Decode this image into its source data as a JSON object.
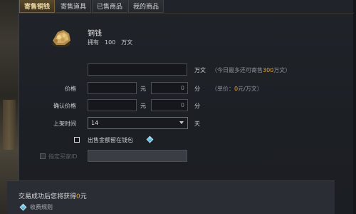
{
  "tabs": [
    {
      "label": "寄售铜钱",
      "active": true
    },
    {
      "label": "寄售道具",
      "active": false
    },
    {
      "label": "已售商品",
      "active": false
    },
    {
      "label": "我的商品",
      "active": false
    }
  ],
  "item": {
    "name": "铜钱",
    "owned_label": "拥有",
    "owned_value": "100",
    "owned_unit": "万文",
    "icon": "copper-coins-icon"
  },
  "form": {
    "amount_value": "",
    "amount_unit": "万文",
    "amount_hint_prefix": "（今日最多还可寄售",
    "amount_hint_highlight": "300",
    "amount_hint_suffix": "万文）",
    "price_label": "价格",
    "price_yuan_value": "",
    "price_yuan_unit": "元",
    "price_fen_value": "0",
    "price_fen_unit": "分",
    "unit_price_prefix": "（单价：",
    "unit_price_value": "0",
    "unit_price_suffix": "元/万文）",
    "confirm_label": "确认价格",
    "confirm_yuan_value": "",
    "confirm_yuan_unit": "元",
    "confirm_fen_value": "0",
    "confirm_fen_unit": "分",
    "duration_label": "上架时间",
    "duration_value": "14",
    "duration_unit": "天",
    "keep_in_wallet_label": "出售金额留在钱包",
    "buyer_id_label": "指定买家ID",
    "buyer_id_value": ""
  },
  "footer": {
    "earn_prefix": "交易成功后您将获得",
    "earn_value": "0",
    "earn_suffix": "元",
    "fee_rules_label": "收费规则"
  },
  "colors": {
    "accent": "#e0a43a",
    "active_tab": "#5a4a2c",
    "diamond": "#3a9ccc"
  }
}
